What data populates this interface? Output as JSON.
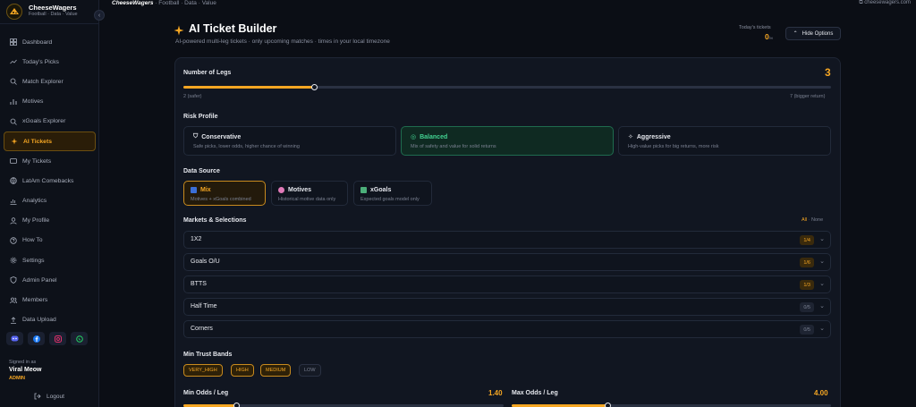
{
  "brand": {
    "name": "CheeseWagers",
    "tagline": "Football · Data · Value"
  },
  "topbar": {
    "crumb_app": "CheeseWagers",
    "crumb_rest": "· Football · Data · Value",
    "site": "cheesewagers.com"
  },
  "nav": [
    {
      "label": "Dashboard",
      "icon": "dashboard-icon"
    },
    {
      "label": "Today's Picks",
      "icon": "trending-icon"
    },
    {
      "label": "Match Explorer",
      "icon": "search-icon"
    },
    {
      "label": "Motives",
      "icon": "bar-chart-icon"
    },
    {
      "label": "xGoals Explorer",
      "icon": "search-icon"
    },
    {
      "label": "AI Tickets",
      "icon": "sparkle-icon",
      "active": true
    },
    {
      "label": "My Tickets",
      "icon": "ticket-icon"
    },
    {
      "label": "LatAm Comebacks",
      "icon": "globe-icon"
    },
    {
      "label": "Analytics",
      "icon": "analytics-icon"
    },
    {
      "label": "My Profile",
      "icon": "user-icon"
    },
    {
      "label": "How To",
      "icon": "help-icon"
    },
    {
      "label": "Settings",
      "icon": "gear-icon"
    },
    {
      "label": "Admin Panel",
      "icon": "shield-icon"
    },
    {
      "label": "Members",
      "icon": "users-icon"
    },
    {
      "label": "Data Upload",
      "icon": "upload-icon"
    }
  ],
  "user": {
    "signed_in_label": "Signed in as",
    "name": "Viral Meow",
    "role": "ADMIN",
    "logout": "Logout"
  },
  "header": {
    "title": "AI Ticket Builder",
    "subtitle": "AI-powered multi-leg tickets · only upcoming matches · times in your local timezone",
    "todays_label": "Today's tickets",
    "todays_value": "0",
    "todays_suffix": "/∞",
    "hide_button": "Hide Options"
  },
  "legs": {
    "label": "Number of Legs",
    "value": "3",
    "level": 0.3,
    "min_label": "2 (safer)",
    "max_label": "7 (bigger return)"
  },
  "risk": {
    "label": "Risk Profile",
    "options": [
      {
        "title": "Conservative",
        "desc": "Safe picks, lower odds, higher chance of winning"
      },
      {
        "title": "Balanced",
        "desc": "Mix of safety and value for solid returns",
        "selected": true
      },
      {
        "title": "Aggressive",
        "desc": "High-value picks for big returns, more risk"
      }
    ]
  },
  "source": {
    "label": "Data Source",
    "options": [
      {
        "title": "Mix",
        "desc": "Motives + xGoals combined",
        "selected": true
      },
      {
        "title": "Motives",
        "desc": "Historical motive data only"
      },
      {
        "title": "xGoals",
        "desc": "Expected goals model only"
      }
    ]
  },
  "markets": {
    "label": "Markets & Selections",
    "all": "All",
    "sep": "·",
    "none": "None",
    "rows": [
      {
        "name": "1X2",
        "badge": "1/4",
        "on": true
      },
      {
        "name": "Goals O/U",
        "badge": "1/6",
        "on": true
      },
      {
        "name": "BTTS",
        "badge": "1/3",
        "on": true
      },
      {
        "name": "Half Time",
        "badge": "0/5",
        "on": false
      },
      {
        "name": "Corners",
        "badge": "0/5",
        "on": false
      }
    ]
  },
  "trust": {
    "label": "Min Trust Bands",
    "bands": [
      {
        "name": "VERY_HIGH",
        "on": true
      },
      {
        "name": "HIGH",
        "on": true
      },
      {
        "name": "MEDIUM",
        "on": true
      },
      {
        "name": "LOW",
        "on": false
      }
    ]
  },
  "odds": {
    "min_label": "Min Odds / Leg",
    "min_value": "1.40",
    "max_label": "Max Odds / Leg",
    "max_value": "4.00"
  },
  "colors": {
    "accent": "#f5a623",
    "success": "#42d392",
    "bg": "#0b0e15"
  }
}
